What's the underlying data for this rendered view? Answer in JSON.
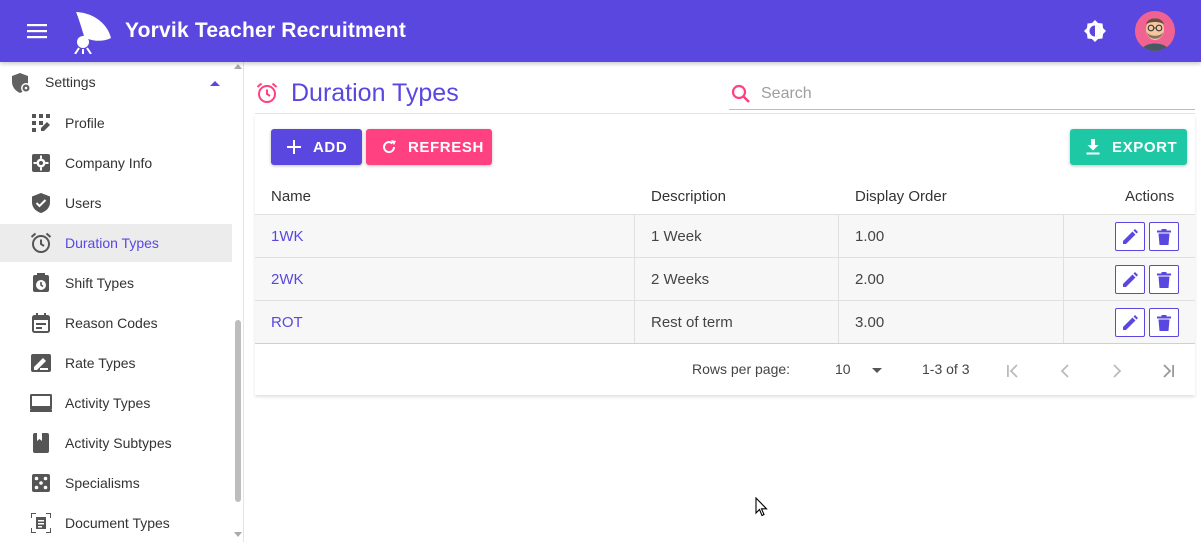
{
  "app": {
    "title": "Yorvik Teacher Recruitment",
    "accent_color": "#5a47e0",
    "secondary_color": "#ff4081",
    "export_color": "#1ec8a5"
  },
  "header": {
    "menu_icon": "menu-icon",
    "logo_icon": "rocket-logo-icon",
    "theme_icon": "brightness-icon",
    "avatar_icon": "user-avatar"
  },
  "sidebar": {
    "section": {
      "label": "Settings",
      "icon": "shield-gear-icon",
      "expanded": true
    },
    "items": [
      {
        "label": "Profile",
        "icon": "grid-pen-icon",
        "active": false
      },
      {
        "label": "Company Info",
        "icon": "gear-box-icon",
        "active": false
      },
      {
        "label": "Users",
        "icon": "shield-check-icon",
        "active": false
      },
      {
        "label": "Duration Types",
        "icon": "alarm-clock-icon",
        "active": true
      },
      {
        "label": "Shift Types",
        "icon": "timer-box-icon",
        "active": false
      },
      {
        "label": "Reason Codes",
        "icon": "calendar-note-icon",
        "active": false
      },
      {
        "label": "Rate Types",
        "icon": "signature-icon",
        "active": false
      },
      {
        "label": "Activity Types",
        "icon": "monitor-icon",
        "active": false
      },
      {
        "label": "Activity Subtypes",
        "icon": "book-icon",
        "active": false
      },
      {
        "label": "Specialisms",
        "icon": "dice-icon",
        "active": false
      },
      {
        "label": "Document Types",
        "icon": "document-scan-icon",
        "active": false
      }
    ]
  },
  "page": {
    "title": "Duration Types",
    "title_icon": "alarm-clock-icon",
    "search": {
      "placeholder": "Search",
      "value": ""
    }
  },
  "toolbar": {
    "add_label": "ADD",
    "refresh_label": "REFRESH",
    "export_label": "EXPORT"
  },
  "table": {
    "columns": [
      "Name",
      "Description",
      "Display Order",
      "Actions"
    ],
    "rows": [
      {
        "name": "1WK",
        "description": "1 Week",
        "display_order": "1.00"
      },
      {
        "name": "2WK",
        "description": "2 Weeks",
        "display_order": "2.00"
      },
      {
        "name": "ROT",
        "description": "Rest of term",
        "display_order": "3.00"
      }
    ]
  },
  "pagination": {
    "rows_per_page_label": "Rows per page:",
    "rows_per_page": "10",
    "range": "1-3 of 3"
  }
}
